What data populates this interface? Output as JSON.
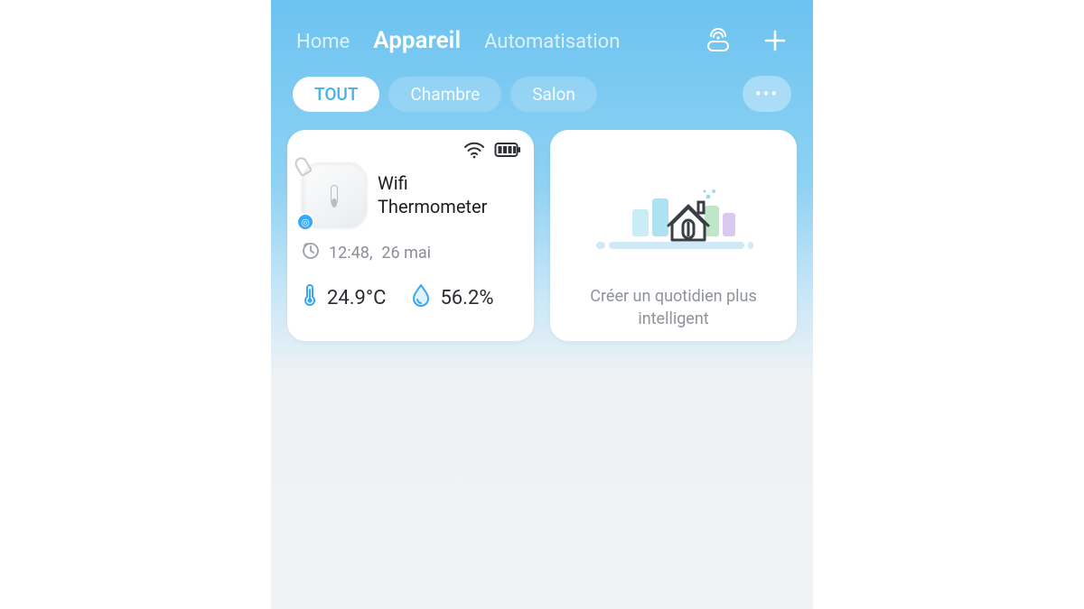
{
  "header": {
    "tabs": [
      {
        "label": "Home",
        "active": false
      },
      {
        "label": "Appareil",
        "active": true
      },
      {
        "label": "Automatisation",
        "active": false
      }
    ]
  },
  "filters": {
    "items": [
      {
        "label": "TOUT",
        "active": true
      },
      {
        "label": "Chambre",
        "active": false
      },
      {
        "label": "Salon",
        "active": false
      }
    ],
    "more_label": "•••"
  },
  "device_card": {
    "name_line1": "Wifi",
    "name_line2": "Thermometer",
    "time": "12:48,",
    "date": "26 mai",
    "temperature": "24.9°C",
    "humidity": "56.2%",
    "badge_glyph": "◎"
  },
  "promo_card": {
    "text": "Créer un quotidien plus intelligent"
  }
}
